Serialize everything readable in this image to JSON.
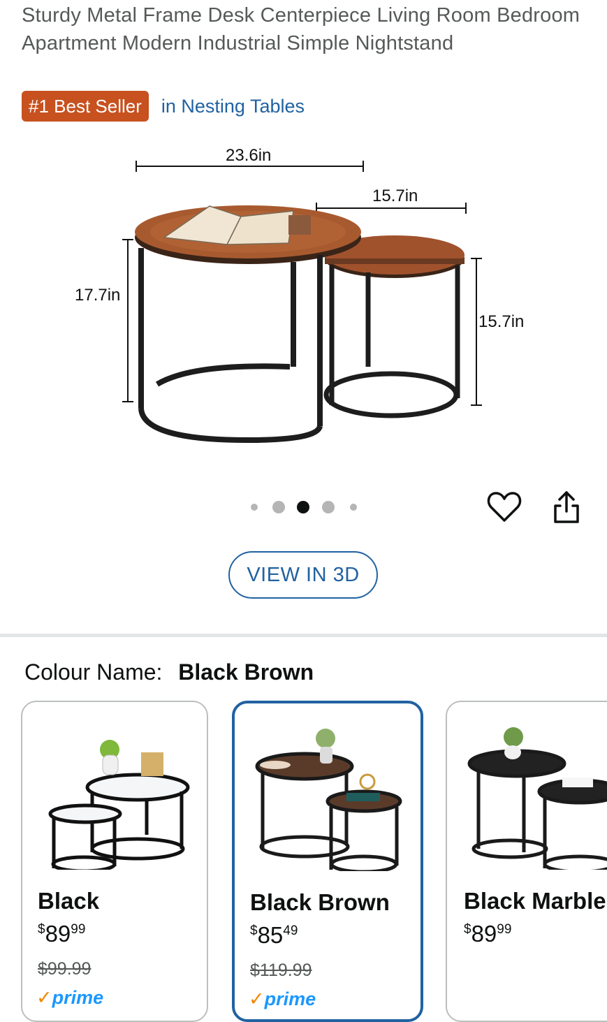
{
  "product": {
    "title": "Sturdy Metal Frame Desk Centerpiece Living Room Bedroom Apartment Modern Industrial Simple Nightstand",
    "badge": "#1 Best Seller",
    "badge_category": "in Nesting Tables"
  },
  "image": {
    "dims": {
      "width_large": "23.6in",
      "width_small": "15.7in",
      "height_large": "17.7in",
      "height_small": "15.7in"
    },
    "carousel": {
      "count": 5,
      "active_index": 2
    }
  },
  "actions": {
    "view_3d": "VIEW IN 3D",
    "wishlist_icon": "heart-icon",
    "share_icon": "share-icon"
  },
  "colour": {
    "label": "Colour Name:",
    "selected": "Black Brown",
    "options": [
      {
        "name": "Black",
        "currency": "$",
        "price_whole": "89",
        "price_fraction": "99",
        "was": "$99.99",
        "prime": "prime"
      },
      {
        "name": "Black Brown",
        "currency": "$",
        "price_whole": "85",
        "price_fraction": "49",
        "was": "$119.99",
        "prime": "prime"
      },
      {
        "name": "Black Marble",
        "currency": "$",
        "price_whole": "89",
        "price_fraction": "99"
      }
    ]
  },
  "colors": {
    "badge": "#c7511f",
    "link": "#2162a1",
    "prime": "#1a98ff",
    "wood": "#a0522d"
  }
}
